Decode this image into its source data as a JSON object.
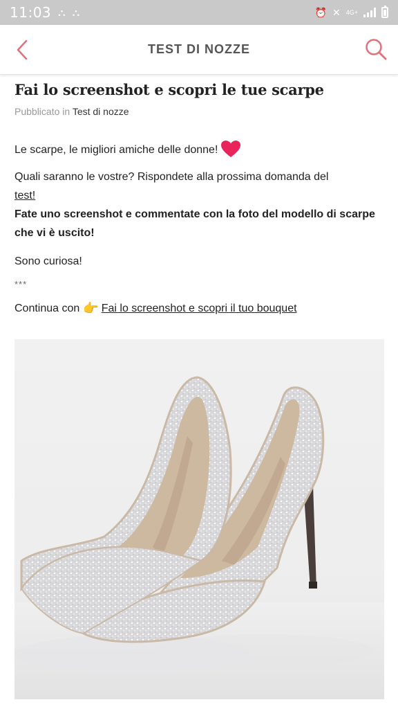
{
  "status_bar": {
    "time": "11:03",
    "net_label": "4G+"
  },
  "header": {
    "title": "TEST DI NOZZE",
    "accent_color": "#e0707a"
  },
  "article": {
    "title": "Fai lo screenshot e scopri le tue scarpe",
    "meta_prefix": "Pubblicato in",
    "meta_category": "Test di nozze",
    "intro": "Le scarpe, le migliori amiche delle donne!",
    "question_text": "Quali saranno le vostre? Rispondete alla prossima domanda del",
    "question_link": "test!",
    "instruction": "Fate uno screenshot e commentate con la foto del modello di scarpe che vi è uscito!",
    "curious": "Sono curiosa!",
    "separator": "***",
    "continue_prefix": "Continua con",
    "continue_link": "Fai lo screenshot e scopri il tuo bouquet"
  },
  "icons": {
    "heart": "heart-icon",
    "hand": "pointing-hand-icon",
    "back": "chevron-left-icon",
    "search": "search-icon"
  }
}
